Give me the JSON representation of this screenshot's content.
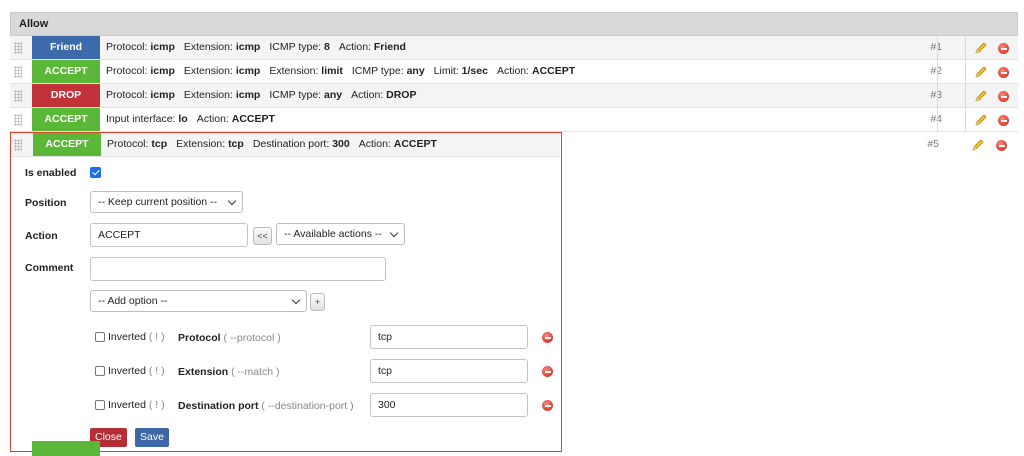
{
  "colors": {
    "friend": "#3d6aab",
    "accept": "#5bb737",
    "drop": "#c3323a",
    "close": "#b52e35",
    "save": "#3d67a8",
    "highlight": "#e0412f"
  },
  "section_title": "Allow",
  "rules": [
    {
      "action": "Friend",
      "color": "friend",
      "number": "#1",
      "parts": [
        {
          "l": "Protocol:",
          "v": "icmp"
        },
        {
          "l": "Extension:",
          "v": "icmp"
        },
        {
          "l": "ICMP type:",
          "v": "8"
        },
        {
          "l": "Action:",
          "v": "Friend"
        }
      ]
    },
    {
      "action": "ACCEPT",
      "color": "accept",
      "number": "#2",
      "parts": [
        {
          "l": "Protocol:",
          "v": "icmp"
        },
        {
          "l": "Extension:",
          "v": "icmp"
        },
        {
          "l": "Extension:",
          "v": "limit"
        },
        {
          "l": "ICMP type:",
          "v": "any"
        },
        {
          "l": "Limit:",
          "v": "1/sec"
        },
        {
          "l": "Action:",
          "v": "ACCEPT"
        }
      ]
    },
    {
      "action": "DROP",
      "color": "drop",
      "number": "#3",
      "parts": [
        {
          "l": "Protocol:",
          "v": "icmp"
        },
        {
          "l": "Extension:",
          "v": "icmp"
        },
        {
          "l": "ICMP type:",
          "v": "any"
        },
        {
          "l": "Action:",
          "v": "DROP"
        }
      ]
    },
    {
      "action": "ACCEPT",
      "color": "accept",
      "number": "#4",
      "parts": [
        {
          "l": "Input interface:",
          "v": "lo"
        },
        {
          "l": "Action:",
          "v": "ACCEPT"
        }
      ]
    }
  ],
  "editing_rule": {
    "action": "ACCEPT",
    "color": "accept",
    "number": "#5",
    "parts": [
      {
        "l": "Protocol:",
        "v": "tcp"
      },
      {
        "l": "Extension:",
        "v": "tcp"
      },
      {
        "l": "Destination port:",
        "v": "300"
      },
      {
        "l": "Action:",
        "v": "ACCEPT"
      }
    ]
  },
  "form": {
    "enabled_label": "Is enabled",
    "enabled": true,
    "position_label": "Position",
    "position_value": "-- Keep current position --",
    "action_label": "Action",
    "action_value": "ACCEPT",
    "copy_button": "<<",
    "available_actions": "-- Available actions --",
    "comment_label": "Comment",
    "comment_value": "",
    "add_option": "-- Add option --",
    "add_button": "+",
    "options": [
      {
        "inverted": "Inverted",
        "hint": "( ! )",
        "name": "Protocol",
        "flag": "( --protocol )",
        "value": "tcp"
      },
      {
        "inverted": "Inverted",
        "hint": "( ! )",
        "name": "Extension",
        "flag": "( --match )",
        "value": "tcp"
      },
      {
        "inverted": "Inverted",
        "hint": "( ! )",
        "name": "Destination port",
        "flag": "( --destination-port )",
        "value": "300"
      }
    ],
    "close_button": "Close",
    "save_button": "Save"
  }
}
